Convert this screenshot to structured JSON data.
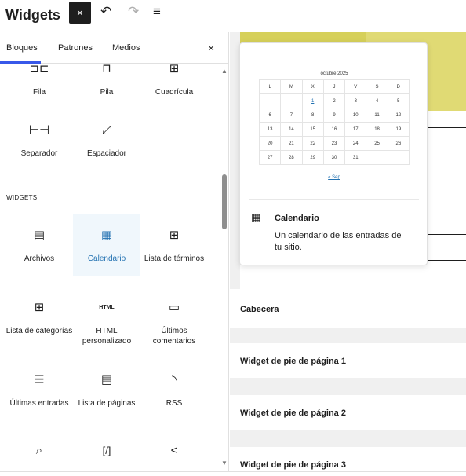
{
  "header": {
    "title": "Widgets",
    "close_icon": "×",
    "undo_icon": "↶",
    "redo_icon": "↷",
    "list_view_icon": "≡"
  },
  "inserter": {
    "tabs": [
      "Bloques",
      "Patrones",
      "Medios"
    ],
    "active_tab": "Bloques",
    "close": "×",
    "design_blocks": [
      {
        "icon": "⊐⊏",
        "label": "Fila"
      },
      {
        "icon": "⊓",
        "label": "Pila"
      },
      {
        "icon": "⊞",
        "label": "Cuadrícula"
      },
      {
        "icon": "⊢⊣",
        "label": "Separador"
      },
      {
        "icon": "⤢",
        "label": "Espaciador"
      }
    ],
    "section_widgets": "WIDGETS",
    "widget_blocks": [
      {
        "icon": "▤",
        "label": "Archivos"
      },
      {
        "icon": "▦",
        "label": "Calendario"
      },
      {
        "icon": "⊞",
        "label": "Lista de términos"
      },
      {
        "icon": "⊞",
        "label": "Lista de categorías"
      },
      {
        "icon": "HTML",
        "label": "HTML personalizado"
      },
      {
        "icon": "▭",
        "label": "Últimos comentarios"
      },
      {
        "icon": "☰",
        "label": "Últimas entradas"
      },
      {
        "icon": "▤",
        "label": "Lista de páginas"
      },
      {
        "icon": "◝",
        "label": "RSS"
      },
      {
        "icon": "⌕",
        "label": ""
      },
      {
        "icon": "[/]",
        "label": ""
      },
      {
        "icon": "<",
        "label": ""
      }
    ]
  },
  "preview": {
    "caption": "octubre 2025",
    "weekdays": [
      "L",
      "M",
      "X",
      "J",
      "V",
      "S",
      "D"
    ],
    "weeks": [
      [
        "",
        "",
        "1",
        "2",
        "3",
        "4",
        "5"
      ],
      [
        "6",
        "7",
        "8",
        "9",
        "10",
        "11",
        "12"
      ],
      [
        "13",
        "14",
        "15",
        "16",
        "17",
        "18",
        "19"
      ],
      [
        "20",
        "21",
        "22",
        "23",
        "24",
        "25",
        "26"
      ],
      [
        "27",
        "28",
        "29",
        "30",
        "31",
        "",
        ""
      ]
    ],
    "linked_day": "1",
    "prev_link": "« Sep",
    "block_icon": "▦",
    "block_title": "Calendario",
    "block_description": "Un calendario de las entradas de tu sitio."
  },
  "canvas": {
    "areas": [
      "Cabecera",
      "Widget de pie de página 1",
      "Widget de pie de página 2",
      "Widget de pie de página 3"
    ]
  },
  "colors": {
    "accent": "#3858e9",
    "selected_bg": "#f0f7fc",
    "selected_text": "#2271b1",
    "banner": "#d6d05a"
  }
}
